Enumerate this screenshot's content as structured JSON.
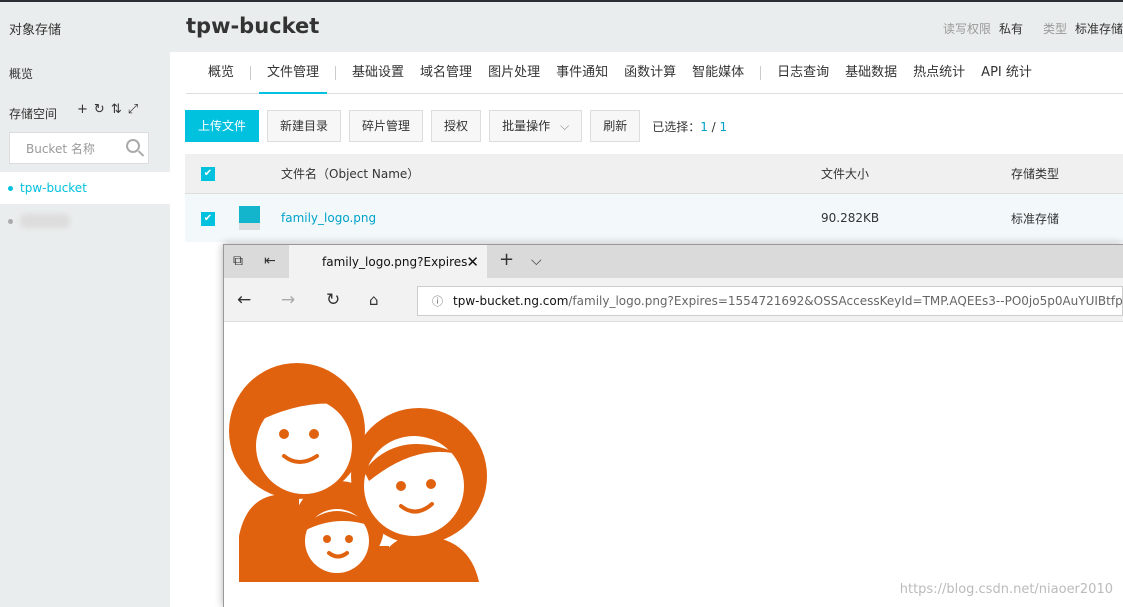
{
  "sidebar": {
    "title": "对象存储",
    "overview": "概览",
    "storage_label": "存储空间",
    "icons": [
      "plus-icon",
      "refresh-icon",
      "sort-icon",
      "expand-icon"
    ],
    "search_placeholder": "Bucket 名称",
    "buckets": [
      {
        "name": "tpw-bucket",
        "active": true
      }
    ]
  },
  "header": {
    "title": "tpw-bucket",
    "acl_label": "读写权限",
    "acl_value": "私有",
    "type_label": "类型",
    "type_value": "标准存储"
  },
  "tabs": [
    "概览",
    "文件管理",
    "基础设置",
    "域名管理",
    "图片处理",
    "事件通知",
    "函数计算",
    "智能媒体",
    "日志查询",
    "基础数据",
    "热点统计",
    "API 统计"
  ],
  "toolbar": {
    "upload": "上传文件",
    "new_dir": "新建目录",
    "fragments": "碎片管理",
    "auth": "授权",
    "batch": "批量操作",
    "refresh": "刷新",
    "selected_label": "已选择：",
    "selected": "1",
    "total": "1"
  },
  "table": {
    "headers": [
      "文件名（Object Name）",
      "文件大小",
      "存储类型"
    ],
    "rows": [
      {
        "name": "family_logo.png",
        "size": "90.282KB",
        "type": "标准存储"
      }
    ]
  },
  "browser": {
    "tab_title": "family_logo.png?Expires",
    "url_host": "tpw-bucket.",
    "url_host2": "ng.com",
    "url_path": "/family_logo.png?Expires=1554721692&OSSAccessKeyId=TMP.AQEEs3--PO0jo5p0AuYUIBtfp"
  },
  "watermark": "https://blog.csdn.net/niaoer2010",
  "colors": {
    "accent": "#00c1de",
    "logo": "#e0620f"
  }
}
